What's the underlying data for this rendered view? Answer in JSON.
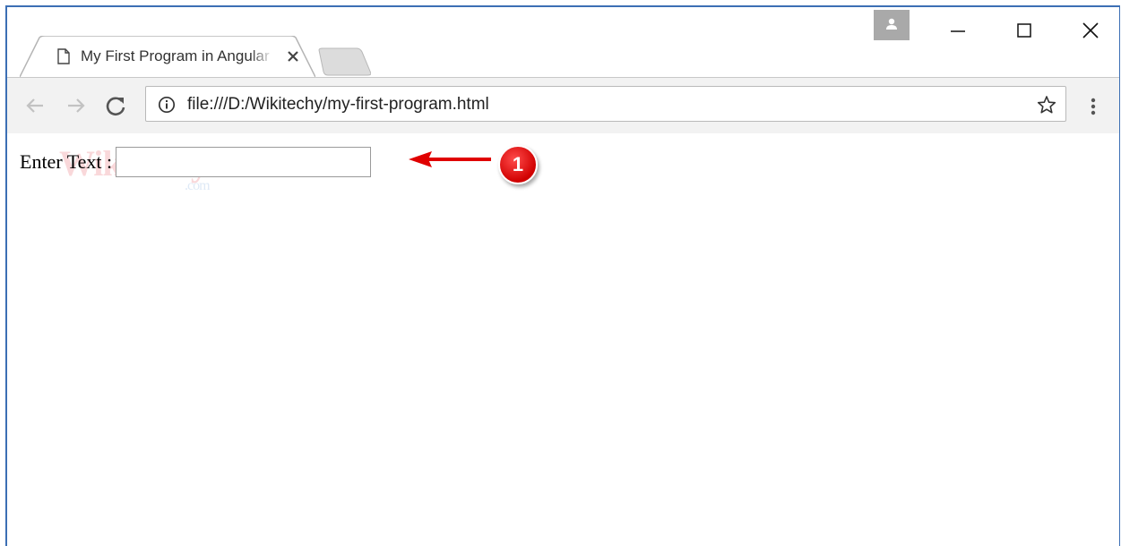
{
  "browser": {
    "tab": {
      "title": "My First Program in Angular"
    },
    "address_bar": {
      "url": "file:///D:/Wikitechy/my-first-program.html"
    },
    "icons": {
      "page": "page-icon",
      "tab_close": "close-icon",
      "new_tab": "new-tab-icon",
      "profile": "profile-icon",
      "minimize": "minimize-icon",
      "maximize": "maximize-icon",
      "close_window": "close-icon",
      "back": "back-arrow-icon",
      "forward": "forward-arrow-icon",
      "reload": "reload-icon",
      "info": "info-icon",
      "bookmark": "star-icon",
      "menu": "more-vert-icon"
    }
  },
  "page": {
    "watermark": {
      "brand": "Wikitechy",
      "domain": ".com"
    },
    "form": {
      "label": "Enter Text :",
      "input_value": ""
    },
    "annotation": {
      "badge_number": "1",
      "badge_color": "#e00000",
      "arrow_color": "#e00000"
    }
  }
}
